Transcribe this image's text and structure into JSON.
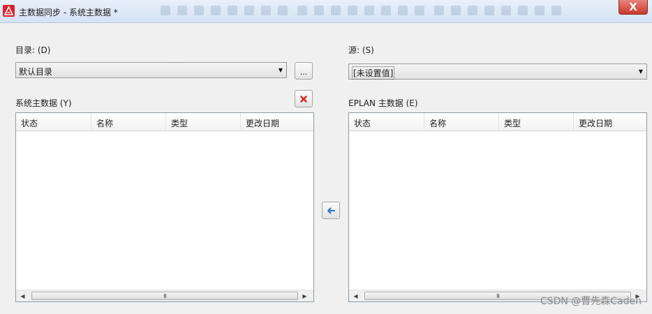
{
  "window": {
    "title": "主数据同步 - 系统主数据 *",
    "close_label": "X"
  },
  "left": {
    "directory_label": "目录: (D)",
    "directory_value": "默认目录",
    "browse_label": "...",
    "list_label": "系统主数据 (Y)",
    "columns": [
      "状态",
      "名称",
      "类型",
      "更改日期"
    ]
  },
  "right": {
    "source_label": "源: (S)",
    "source_value": "[未设置值]",
    "list_label": "EPLAN 主数据 (E)",
    "columns": [
      "状态",
      "名称",
      "类型",
      "更改日期"
    ]
  },
  "scrollbar": {
    "grip": "III"
  },
  "watermark": "CSDN @曹先森Caden",
  "colors": {
    "delete_accent": "#d62020",
    "arrow_accent": "#2a6fc9"
  },
  "icons": {
    "delete": "x-icon",
    "transfer": "arrow-left-icon",
    "dropdown": "caret-down-icon"
  }
}
